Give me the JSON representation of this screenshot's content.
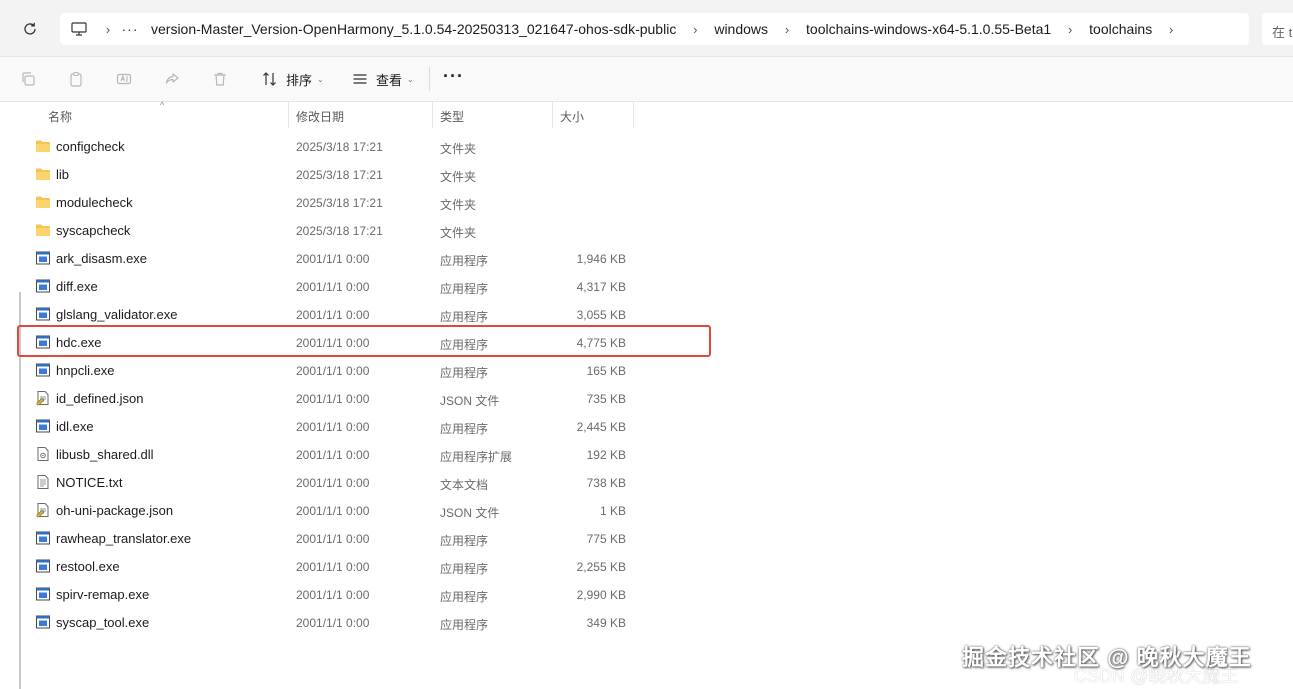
{
  "address_bar": {
    "overflow": "···",
    "crumbs": [
      "version-Master_Version-OpenHarmony_5.1.0.54-20250313_021647-ohos-sdk-public",
      "windows",
      "toolchains-windows-x64-5.1.0.55-Beta1",
      "toolchains"
    ],
    "search_prefix": "在 t"
  },
  "toolbar": {
    "sort_label": "排序",
    "view_label": "查看",
    "more_label": "···"
  },
  "columns": {
    "name": "名称",
    "date": "修改日期",
    "type": "类型",
    "size": "大小"
  },
  "files": [
    {
      "name": "configcheck",
      "date": "2025/3/18 17:21",
      "type": "文件夹",
      "size": "",
      "icon": "folder-icon"
    },
    {
      "name": "lib",
      "date": "2025/3/18 17:21",
      "type": "文件夹",
      "size": "",
      "icon": "folder-icon"
    },
    {
      "name": "modulecheck",
      "date": "2025/3/18 17:21",
      "type": "文件夹",
      "size": "",
      "icon": "folder-icon"
    },
    {
      "name": "syscapcheck",
      "date": "2025/3/18 17:21",
      "type": "文件夹",
      "size": "",
      "icon": "folder-icon"
    },
    {
      "name": "ark_disasm.exe",
      "date": "2001/1/1 0:00",
      "type": "应用程序",
      "size": "1,946 KB",
      "icon": "exe-icon"
    },
    {
      "name": "diff.exe",
      "date": "2001/1/1 0:00",
      "type": "应用程序",
      "size": "4,317 KB",
      "icon": "exe-icon"
    },
    {
      "name": "glslang_validator.exe",
      "date": "2001/1/1 0:00",
      "type": "应用程序",
      "size": "3,055 KB",
      "icon": "exe-icon"
    },
    {
      "name": "hdc.exe",
      "date": "2001/1/1 0:00",
      "type": "应用程序",
      "size": "4,775 KB",
      "icon": "exe-icon"
    },
    {
      "name": "hnpcli.exe",
      "date": "2001/1/1 0:00",
      "type": "应用程序",
      "size": "165 KB",
      "icon": "exe-icon"
    },
    {
      "name": "id_defined.json",
      "date": "2001/1/1 0:00",
      "type": "JSON 文件",
      "size": "735 KB",
      "icon": "json-icon"
    },
    {
      "name": "idl.exe",
      "date": "2001/1/1 0:00",
      "type": "应用程序",
      "size": "2,445 KB",
      "icon": "exe-icon"
    },
    {
      "name": "libusb_shared.dll",
      "date": "2001/1/1 0:00",
      "type": "应用程序扩展",
      "size": "192 KB",
      "icon": "dll-icon"
    },
    {
      "name": "NOTICE.txt",
      "date": "2001/1/1 0:00",
      "type": "文本文档",
      "size": "738 KB",
      "icon": "txt-icon"
    },
    {
      "name": "oh-uni-package.json",
      "date": "2001/1/1 0:00",
      "type": "JSON 文件",
      "size": "1 KB",
      "icon": "json-icon"
    },
    {
      "name": "rawheap_translator.exe",
      "date": "2001/1/1 0:00",
      "type": "应用程序",
      "size": "775 KB",
      "icon": "exe-icon"
    },
    {
      "name": "restool.exe",
      "date": "2001/1/1 0:00",
      "type": "应用程序",
      "size": "2,255 KB",
      "icon": "exe-icon"
    },
    {
      "name": "spirv-remap.exe",
      "date": "2001/1/1 0:00",
      "type": "应用程序",
      "size": "2,990 KB",
      "icon": "exe-icon"
    },
    {
      "name": "syscap_tool.exe",
      "date": "2001/1/1 0:00",
      "type": "应用程序",
      "size": "349 KB",
      "icon": "exe-icon"
    }
  ],
  "highlighted_file": "hdc.exe",
  "highlight_color": "#e0483e",
  "folder_color": "#f6c44f",
  "watermark": "掘金技术社区 @ 晚秋大魔王",
  "watermark_csdn": "CSDN @晚秋大魔王"
}
